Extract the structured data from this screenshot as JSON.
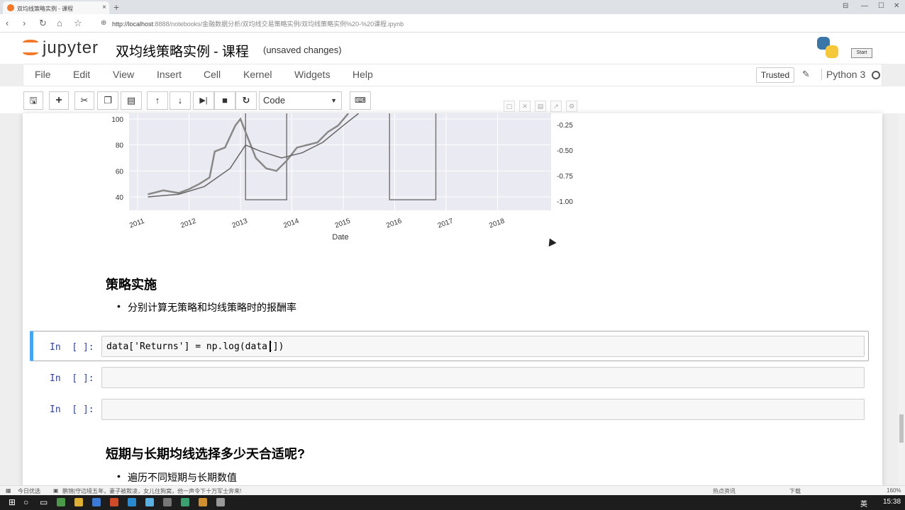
{
  "browser": {
    "tab_title": "双均线策略实例 - 课程",
    "tab_close": "×",
    "new_tab": "+",
    "url_host": "http://localhost",
    "url_rest": ":8888/notebooks/金融数据分析/双均线交易策略实例/双均线策略实例%20-%20课程.ipynb",
    "window_controls": [
      "⊟",
      "—",
      "☐",
      "✕"
    ]
  },
  "header": {
    "logo_text": "jupyter",
    "notebook_title": "双均线策略实例 - 课程",
    "save_status": "(unsaved changes)",
    "start_button": "Start"
  },
  "menu": {
    "items": [
      "File",
      "Edit",
      "View",
      "Insert",
      "Cell",
      "Kernel",
      "Widgets",
      "Help"
    ],
    "trusted": "Trusted",
    "kernel_name": "Python 3"
  },
  "toolbar": {
    "buttons": [
      "save-icon",
      "plus-icon",
      "scissors-icon",
      "copy-icon",
      "paste-icon",
      "arrow-up-icon",
      "arrow-down-icon",
      "run-icon",
      "stop-icon",
      "restart-icon"
    ],
    "cell_type": "Code",
    "keyboard_icon": "keyboard-icon"
  },
  "chart_data": {
    "type": "line",
    "xlabel": "Date",
    "x_ticks": [
      "2011",
      "2012",
      "2013",
      "2014",
      "2015",
      "2016",
      "2017",
      "2018"
    ],
    "y_left_ticks": [
      "100",
      "80",
      "60",
      "40"
    ],
    "y_right_ticks": [
      "-0.25",
      "-0.50",
      "-0.75",
      "-1.00"
    ],
    "series": [
      {
        "values": [
          [
            2011.2,
            42
          ],
          [
            2011.5,
            45
          ],
          [
            2011.8,
            43
          ],
          [
            2012.0,
            46
          ],
          [
            2012.2,
            50
          ],
          [
            2012.4,
            55
          ],
          [
            2012.5,
            75
          ],
          [
            2012.7,
            78
          ],
          [
            2012.9,
            95
          ],
          [
            2013.0,
            100
          ],
          [
            2013.1,
            90
          ],
          [
            2013.3,
            70
          ],
          [
            2013.5,
            62
          ],
          [
            2013.7,
            60
          ],
          [
            2013.9,
            68
          ],
          [
            2014.1,
            78
          ],
          [
            2014.3,
            80
          ],
          [
            2014.5,
            82
          ],
          [
            2014.7,
            90
          ],
          [
            2014.9,
            95
          ],
          [
            2015.1,
            105
          ]
        ]
      },
      {
        "values": [
          [
            2011.2,
            40
          ],
          [
            2011.8,
            42
          ],
          [
            2012.3,
            48
          ],
          [
            2012.8,
            62
          ],
          [
            2013.1,
            80
          ],
          [
            2013.4,
            75
          ],
          [
            2013.8,
            70
          ],
          [
            2014.2,
            74
          ],
          [
            2014.6,
            82
          ],
          [
            2015.0,
            95
          ],
          [
            2015.3,
            105
          ]
        ]
      }
    ],
    "signal_spans": [
      [
        2013.1,
        2013.9
      ],
      [
        2015.9,
        2016.8
      ]
    ]
  },
  "sections": {
    "strategy_heading": "策略实施",
    "strategy_bullet": "分别计算无策略和均线策略时的报酬率",
    "period_heading": "短期与长期均线选择多少天合适呢?",
    "period_bullet": "遍历不同短期与长期数值"
  },
  "cells": [
    {
      "prompt": "In  [ ]:",
      "code": "data['Returns'] = np.log(data[])"
    },
    {
      "prompt": "In  [ ]:",
      "code": ""
    },
    {
      "prompt": "In  [ ]:",
      "code": ""
    }
  ],
  "statusbar": {
    "left_text": "今日优选",
    "news": "鹏锦|守边境五年，妻子被欺凌，女儿住狗窝，他一声令下十万军士奔来!",
    "right_text": "热点资讯",
    "download": "下载",
    "zoom": "160%"
  },
  "taskbar": {
    "ime": "英",
    "time": "15:38"
  }
}
